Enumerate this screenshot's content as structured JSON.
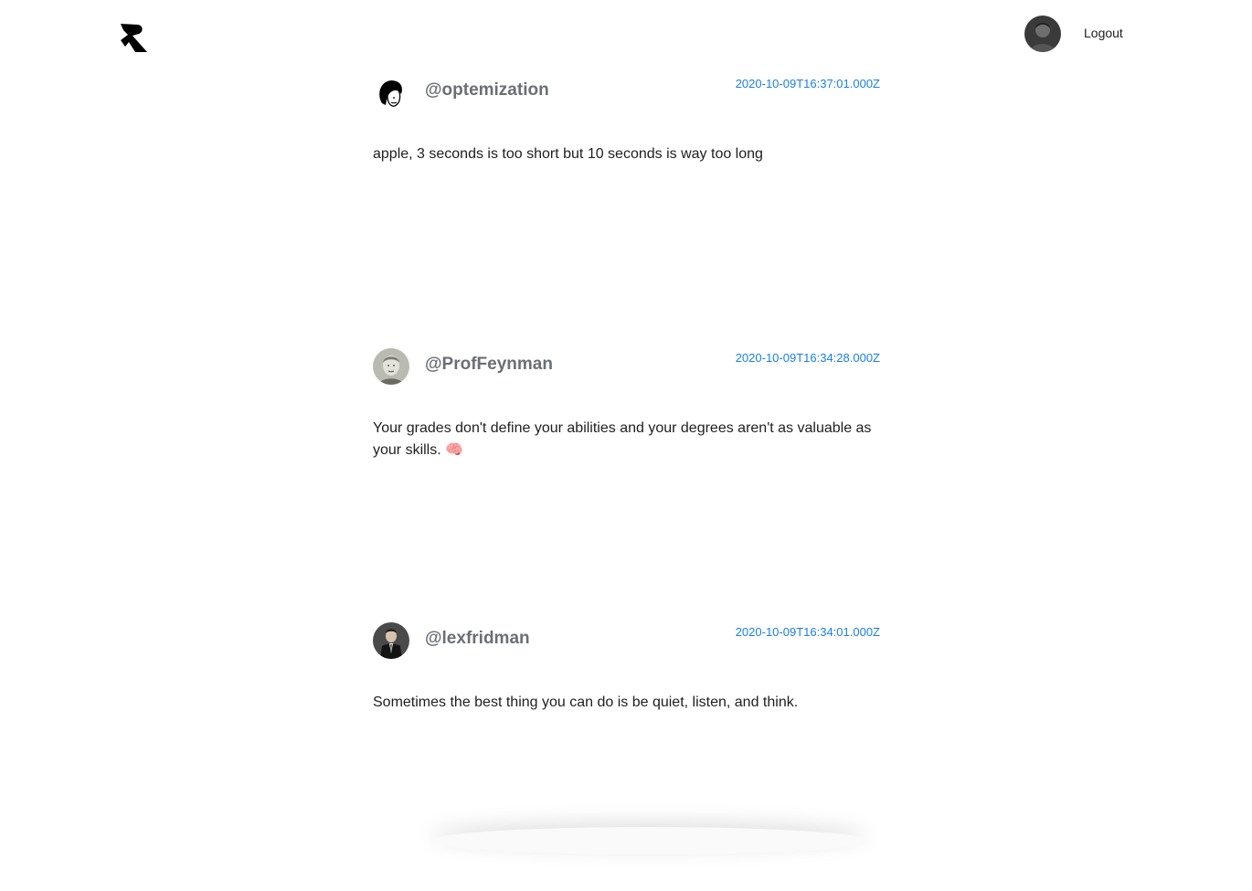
{
  "header": {
    "logo_icon": "r-logo-icon",
    "avatar_icon": "user-avatar-icon",
    "logout_label": "Logout"
  },
  "posts": [
    {
      "username": "@optemization",
      "timestamp": "2020-10-09T16:37:01.000Z",
      "body": "apple, 3 seconds is too short but 10 seconds is way too long"
    },
    {
      "username": "@ProfFeynman",
      "timestamp": "2020-10-09T16:34:28.000Z",
      "body": "Your grades don't define your abilities and your degrees aren't as valuable as your skills. 🧠"
    },
    {
      "username": "@lexfridman",
      "timestamp": "2020-10-09T16:34:01.000Z",
      "body": "Sometimes the best thing you can do is be quiet, listen, and think."
    }
  ],
  "colors": {
    "link": "#1a7fe6",
    "username": "#6b6f75",
    "text": "#1f1f1f"
  }
}
